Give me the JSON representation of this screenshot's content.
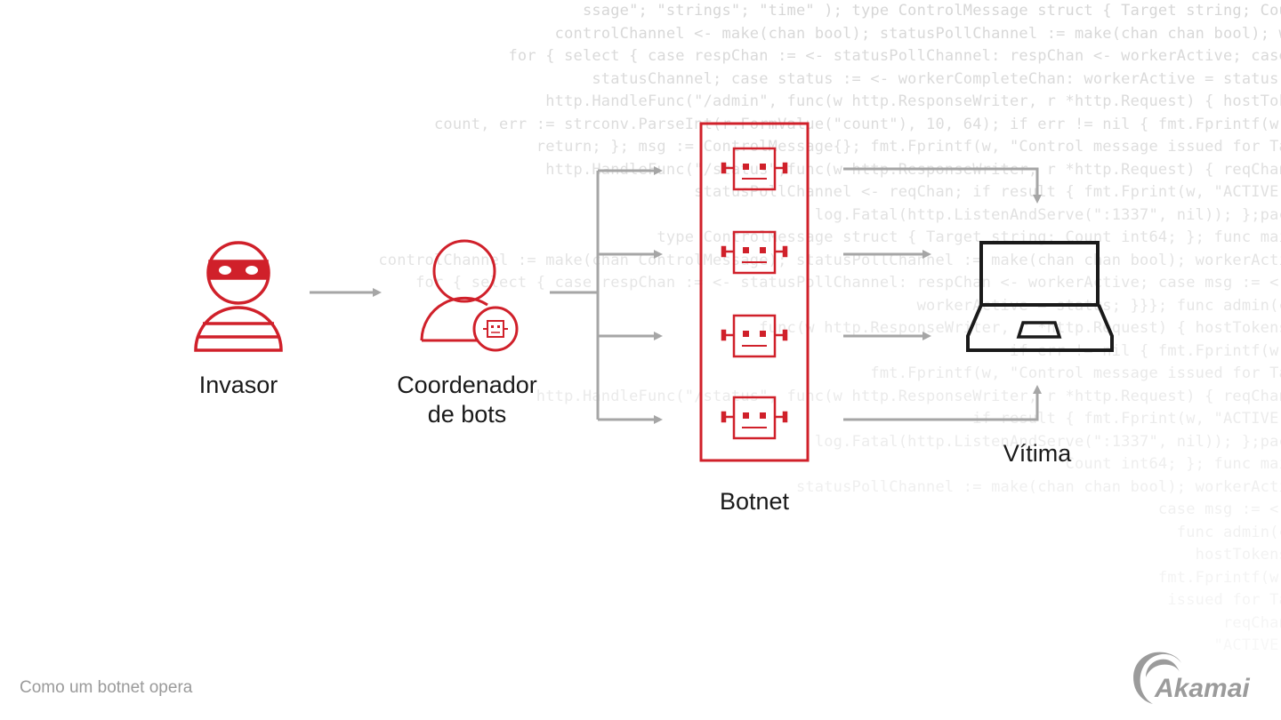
{
  "diagram": {
    "nodes": {
      "attacker": {
        "label": "Invasor",
        "icon": "masked-attacker-icon"
      },
      "bot_herder": {
        "label_line1": "Coordenador",
        "label_line2": "de bots",
        "icon": "user-with-bot-badge-icon"
      },
      "botnet": {
        "label": "Botnet",
        "icon": "bot-icon",
        "bot_count": 4
      },
      "victim": {
        "label": "Vítima",
        "icon": "laptop-icon"
      }
    },
    "edges": [
      {
        "from": "attacker",
        "to": "bot_herder"
      },
      {
        "from": "bot_herder",
        "to": "botnet",
        "fanout": 4
      },
      {
        "from": "botnet",
        "to": "victim",
        "count": 4
      }
    ]
  },
  "caption": "Como um botnet opera",
  "brand": {
    "name": "Akamai"
  },
  "colors": {
    "accent_red": "#d0202a",
    "arrow_gray": "#a6a6a6",
    "text_dark": "#1a1a1a",
    "caption_gray": "#9a9a9a",
    "laptop_black": "#1a1a1a",
    "logo_gray": "#9b9b9b"
  },
  "background_code": [
    "ssage\"; \"strings\"; \"time\" ); type ControlMessage struct { Target string; Cou",
    "controlChannel <- make(chan bool); statusPollChannel := make(chan chan bool); w",
    "for { select { case respChan := <- statusPollChannel: respChan <- workerActive; case",
    "statusChannel; case status := <- workerCompleteChan: workerActive = status;",
    "http.HandleFunc(\"/admin\", func(w http.ResponseWriter, r *http.Request) { hostTok",
    "count, err := strconv.ParseInt(r.FormValue(\"count\"), 10, 64); if err != nil { fmt.Fprintf(w,",
    "return; }; msg := ControlMessage{}; fmt.Fprintf(w, \"Control message issued for Ta",
    "http.HandleFunc(\"/status\",func(w http.ResponseWriter, r *http.Request) { reqChan",
    "statusPollChannel <- reqChan; if result { fmt.Fprint(w, \"ACTIVE\"",
    "log.Fatal(http.ListenAndServe(\":1337\", nil)); };pac",
    "type ControlMessage struct { Target string; Count int64; }; func mai",
    "controlChannel := make(chan ControlMessage); statusPollChannel := make(chan chan bool); workerActi",
    "for { select { case respChan := <- statusPollChannel: respChan <- workerActive; case msg := <-",
    "workerActive = status; }}}; func admin(c",
    "func(w http.ResponseWriter, r *http.Request) { hostTokens",
    "if err != nil { fmt.Fprintf(w,",
    "fmt.Fprintf(w, \"Control message issued for Ta",
    "http.HandleFunc(\"/status\", func(w http.ResponseWriter, r *http.Request) { reqChan",
    "if result { fmt.Fprint(w, \"ACTIVE\"",
    "log.Fatal(http.ListenAndServe(\":1337\", nil)); };pac",
    "Count int64; }; func mai",
    "statusPollChannel := make(chan chan bool); workerActi",
    "case msg := <-",
    "func admin(c",
    "hostTokens",
    "fmt.Fprintf(w,",
    "issued for Ta",
    "reqChan",
    "\"ACTIVE\""
  ]
}
